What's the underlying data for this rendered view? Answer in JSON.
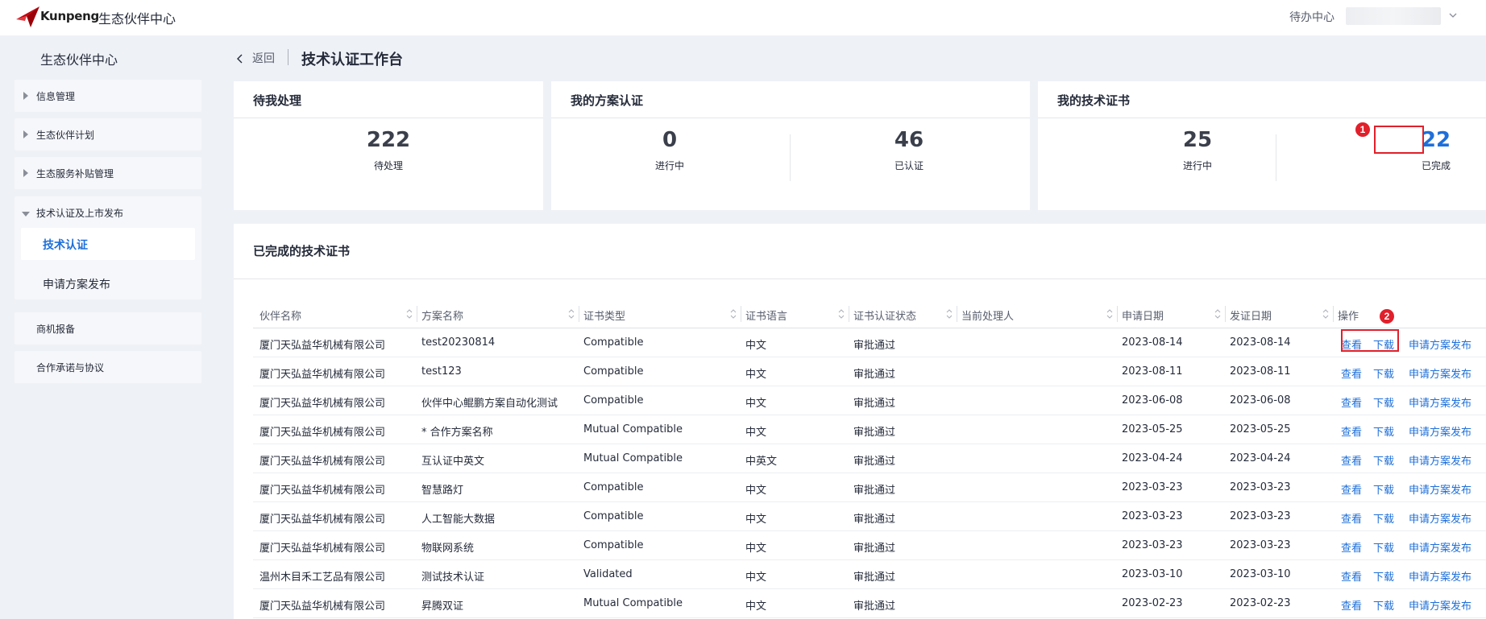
{
  "header": {
    "brand": "Kunpeng",
    "app_name": "生态伙伴中心",
    "todo_link": "待办中心"
  },
  "sidebar": {
    "title": "生态伙伴中心",
    "items": [
      {
        "label": "信息管理"
      },
      {
        "label": "生态伙伴计划"
      },
      {
        "label": "生态服务补贴管理"
      }
    ],
    "group": {
      "label": "技术认证及上市发布",
      "children": [
        {
          "label": "技术认证",
          "active": true
        },
        {
          "label": "申请方案发布"
        }
      ]
    },
    "items_after": [
      {
        "label": "商机报备"
      },
      {
        "label": "合作承诺与协议"
      }
    ]
  },
  "page": {
    "back_label": "返回",
    "title": "技术认证工作台"
  },
  "cards": {
    "pending": {
      "title": "待我处理",
      "stats": [
        {
          "value": "222",
          "label": "待处理"
        }
      ]
    },
    "solution": {
      "title": "我的方案认证",
      "stats": [
        {
          "value": "0",
          "label": "进行中"
        },
        {
          "value": "46",
          "label": "已认证"
        }
      ]
    },
    "certificate": {
      "title": "我的技术证书",
      "stats": [
        {
          "value": "25",
          "label": "进行中"
        },
        {
          "value": "22",
          "label": "已完成"
        }
      ]
    }
  },
  "annotations": {
    "marker1": "1",
    "marker2": "2"
  },
  "table": {
    "title": "已完成的技术证书",
    "columns": [
      "伙伴名称",
      "方案名称",
      "证书类型",
      "证书语言",
      "证书认证状态",
      "当前处理人",
      "申请日期",
      "发证日期",
      "操作"
    ],
    "actions": {
      "view": "查看",
      "download": "下载",
      "publish": "申请方案发布"
    },
    "rows": [
      {
        "partner": "厦门天弘益华机械有限公司",
        "solution": "test20230814",
        "type": "Compatible",
        "lang": "中文",
        "status": "审批通过",
        "handler": "",
        "apply": "2023-08-14",
        "issue": "2023-08-14"
      },
      {
        "partner": "厦门天弘益华机械有限公司",
        "solution": "test123",
        "type": "Compatible",
        "lang": "中文",
        "status": "审批通过",
        "handler": "",
        "apply": "2023-08-11",
        "issue": "2023-08-11"
      },
      {
        "partner": "厦门天弘益华机械有限公司",
        "solution": "伙伴中心鲲鹏方案自动化测试",
        "type": "Compatible",
        "lang": "中文",
        "status": "审批通过",
        "handler": "",
        "apply": "2023-06-08",
        "issue": "2023-06-08"
      },
      {
        "partner": "厦门天弘益华机械有限公司",
        "solution": "* 合作方案名称",
        "type": "Mutual Compatible",
        "lang": "中文",
        "status": "审批通过",
        "handler": "",
        "apply": "2023-05-25",
        "issue": "2023-05-25"
      },
      {
        "partner": "厦门天弘益华机械有限公司",
        "solution": "互认证中英文",
        "type": "Mutual Compatible",
        "lang": "中英文",
        "status": "审批通过",
        "handler": "",
        "apply": "2023-04-24",
        "issue": "2023-04-24"
      },
      {
        "partner": "厦门天弘益华机械有限公司",
        "solution": "智慧路灯",
        "type": "Compatible",
        "lang": "中文",
        "status": "审批通过",
        "handler": "",
        "apply": "2023-03-23",
        "issue": "2023-03-23"
      },
      {
        "partner": "厦门天弘益华机械有限公司",
        "solution": "人工智能大数据",
        "type": "Compatible",
        "lang": "中文",
        "status": "审批通过",
        "handler": "",
        "apply": "2023-03-23",
        "issue": "2023-03-23"
      },
      {
        "partner": "厦门天弘益华机械有限公司",
        "solution": "物联网系统",
        "type": "Compatible",
        "lang": "中文",
        "status": "审批通过",
        "handler": "",
        "apply": "2023-03-23",
        "issue": "2023-03-23"
      },
      {
        "partner": "温州木目禾工艺品有限公司",
        "solution": "测试技术认证",
        "type": "Validated",
        "lang": "中文",
        "status": "审批通过",
        "handler": "",
        "apply": "2023-03-10",
        "issue": "2023-03-10"
      },
      {
        "partner": "厦门天弘益华机械有限公司",
        "solution": "昇腾双证",
        "type": "Mutual Compatible",
        "lang": "中文",
        "status": "审批通过",
        "handler": "",
        "apply": "2023-02-23",
        "issue": "2023-02-23"
      }
    ]
  }
}
